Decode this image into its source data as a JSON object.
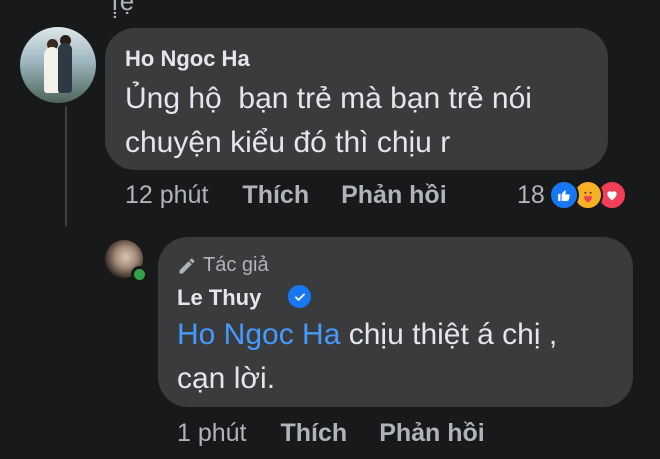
{
  "top_fragment": "ị̣ệ",
  "comments": [
    {
      "author": "Ho Ngoc Ha",
      "lines": [
        "Ủng hộ  bạn trẻ mà bạn trẻ nói",
        "chuyện kiểu đó thì chịu r"
      ],
      "time": "12 phút",
      "like_label": "Thích",
      "reply_label": "Phản hồi",
      "reaction_count": "18",
      "reaction_icons": [
        "like-icon",
        "care-icon",
        "love-icon"
      ]
    },
    {
      "badge": "Tác giả",
      "author": "Le Thuy",
      "verified": true,
      "mention": "Ho Ngoc Ha",
      "line1_rest": " chịu thiệt á chị ,",
      "line2": "cạn lời.",
      "time": "1 phút",
      "like_label": "Thích",
      "reply_label": "Phản hồi"
    }
  ],
  "colors": {
    "background": "#18191a",
    "bubble": "#3a3b3c",
    "mention": "#4599ff",
    "like": "#1877f2",
    "care": "#f7b125",
    "love": "#f33e58",
    "online": "#31a24c"
  }
}
